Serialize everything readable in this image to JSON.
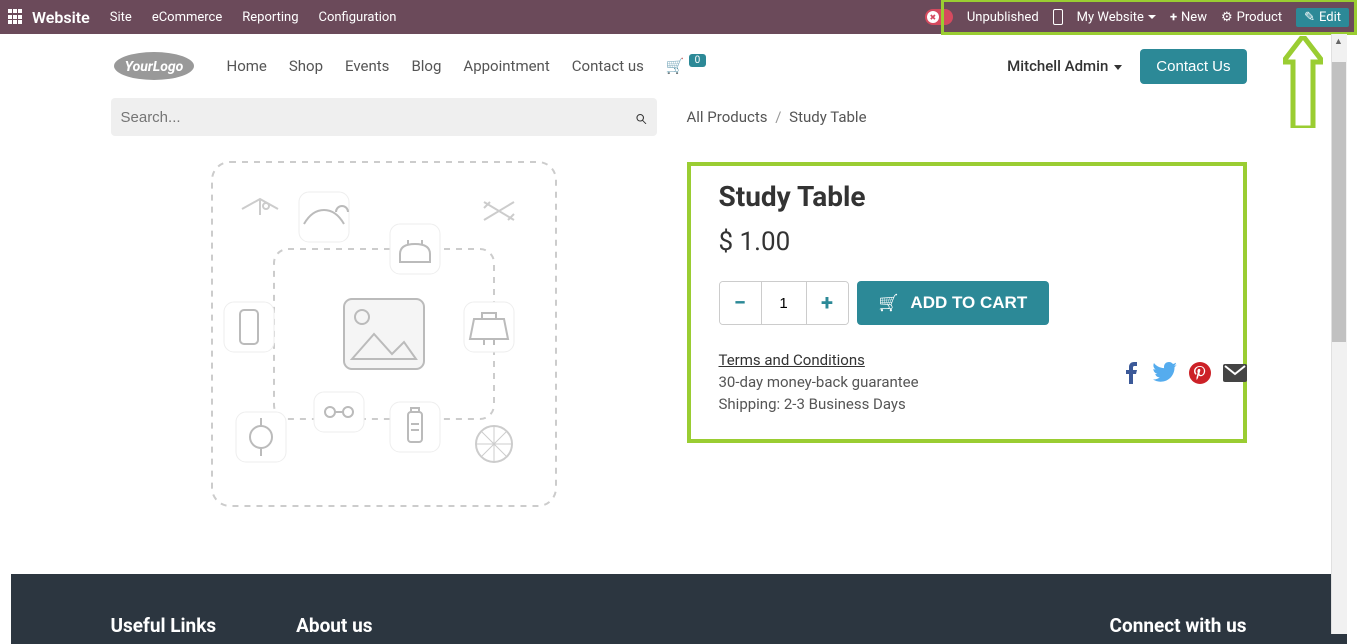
{
  "topbar": {
    "app": "Website",
    "menu": [
      "Site",
      "eCommerce",
      "Reporting",
      "Configuration"
    ],
    "publish_label": "Unpublished",
    "website_label": "My Website",
    "new_label": "New",
    "product_label": "Product",
    "edit_label": "Edit"
  },
  "header": {
    "logo_text": "YourLogo",
    "nav": [
      "Home",
      "Shop",
      "Events",
      "Blog",
      "Appointment",
      "Contact us"
    ],
    "cart_count": "0",
    "user": "Mitchell Admin",
    "contact_btn": "Contact Us"
  },
  "search": {
    "placeholder": "Search..."
  },
  "breadcrumb": {
    "root": "All Products",
    "current": "Study Table"
  },
  "product": {
    "title": "Study Table",
    "price": "$ 1.00",
    "qty": "1",
    "add_label": "ADD TO CART",
    "terms": "Terms and Conditions",
    "guarantee": "30-day money-back guarantee",
    "shipping": "Shipping: 2-3 Business Days"
  },
  "footer": {
    "c1": "Useful Links",
    "c2": "About us",
    "c3": "Connect with us"
  }
}
